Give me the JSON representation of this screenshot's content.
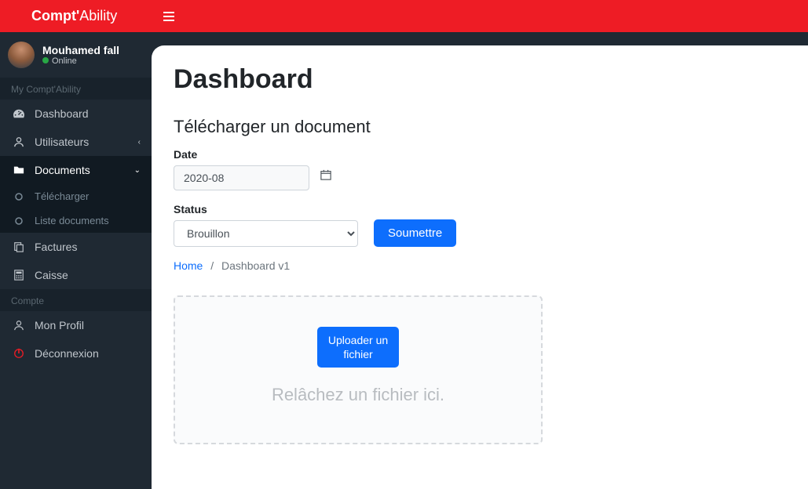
{
  "brand": {
    "part1": "Compt'",
    "part2": "Ability"
  },
  "user": {
    "name": "Mouhamed fall",
    "status": "Online"
  },
  "nav": {
    "header1": "My Compt'Ability",
    "dashboard": "Dashboard",
    "users": "Utilisateurs",
    "documents": "Documents",
    "download": "Télécharger",
    "list_docs": "Liste documents",
    "invoices": "Factures",
    "cash": "Caisse",
    "header2": "Compte",
    "profile": "Mon Profil",
    "logout": "Déconnexion"
  },
  "page": {
    "title": "Dashboard",
    "section_title": "Télécharger un document",
    "date_label": "Date",
    "date_value": "2020-08",
    "status_label": "Status",
    "status_value": "Brouillon",
    "submit": "Soumettre",
    "breadcrumb_home": "Home",
    "breadcrumb_current": "Dashboard v1",
    "upload_btn": "Uploader un fichier",
    "drop_hint": "Relâchez un fichier ici."
  }
}
